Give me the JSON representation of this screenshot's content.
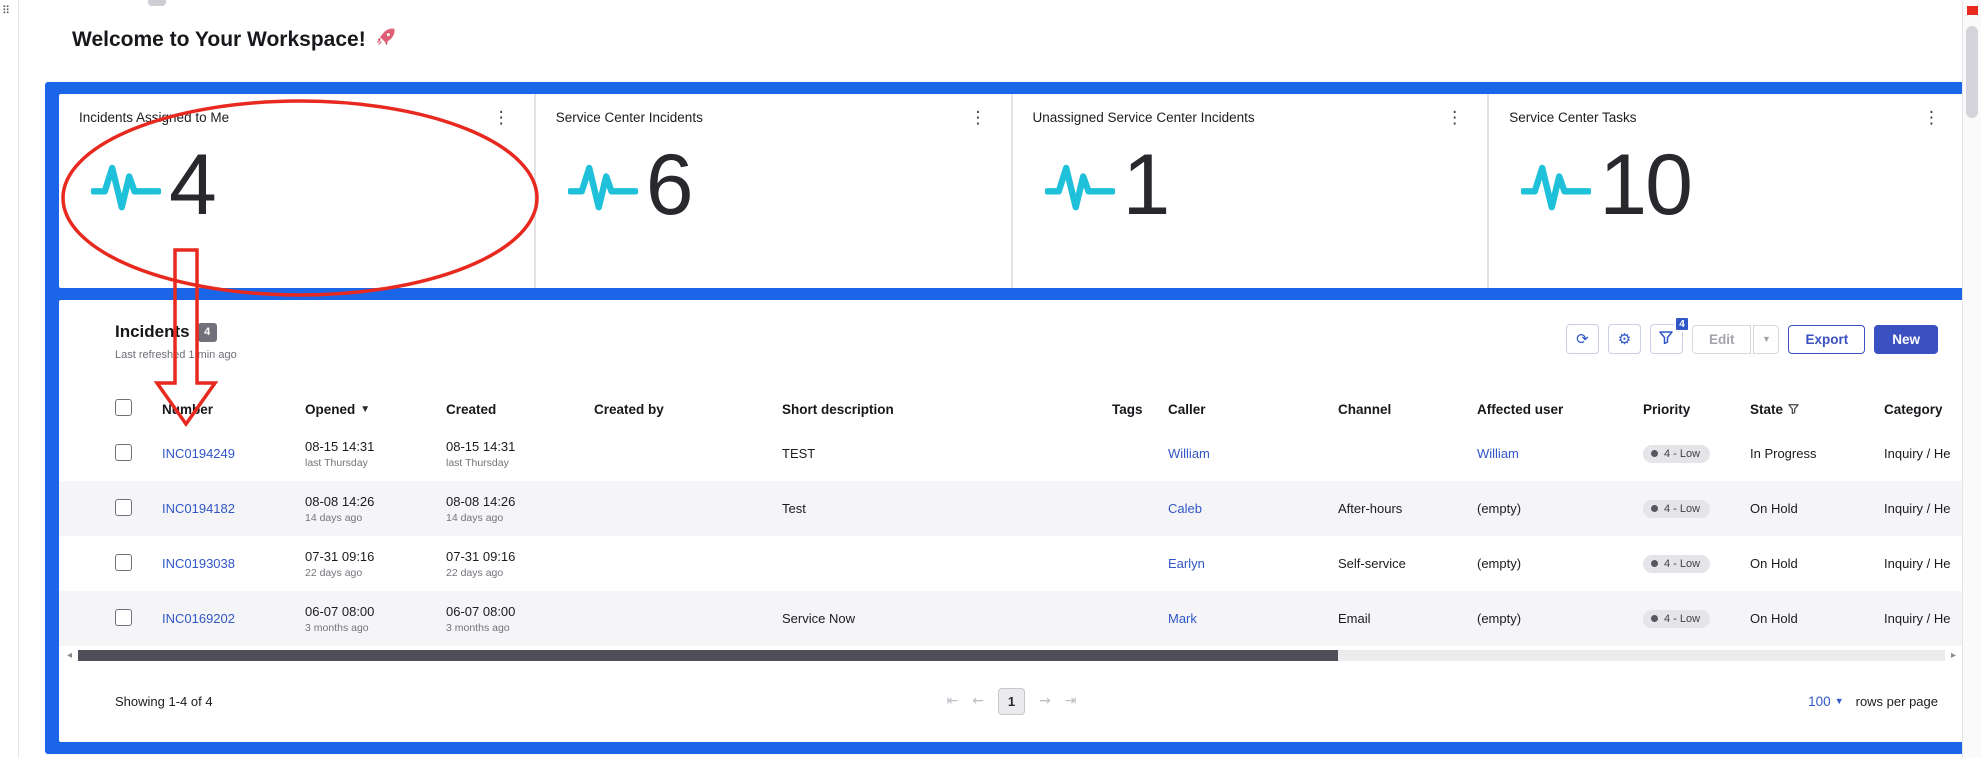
{
  "page": {
    "welcome_title": "Welcome to Your Workspace!",
    "title_icon": "rocket-emoji"
  },
  "cards": [
    {
      "title": "Incidents Assigned to Me",
      "value": "4",
      "icon": "pulse-icon",
      "menu_icon": "kebab-menu-icon"
    },
    {
      "title": "Service Center Incidents",
      "value": "6",
      "icon": "pulse-icon",
      "menu_icon": "kebab-menu-icon"
    },
    {
      "title": "Unassigned Service Center Incidents",
      "value": "1",
      "icon": "pulse-icon",
      "menu_icon": "kebab-menu-icon"
    },
    {
      "title": "Service Center Tasks",
      "value": "10",
      "icon": "pulse-icon",
      "menu_icon": "kebab-menu-icon"
    }
  ],
  "incidents": {
    "title": "Incidents",
    "count_badge": "4",
    "last_refreshed": "Last refreshed 1 min ago",
    "toolbar": {
      "refresh_icon": "⟳",
      "settings_icon": "⚙",
      "filter_badge": "4",
      "edit_label": "Edit",
      "edit_caret": "▼",
      "export_label": "Export",
      "new_label": "New"
    },
    "columns": {
      "number": "Number",
      "opened": "Opened",
      "created": "Created",
      "created_by": "Created by",
      "short_description": "Short description",
      "tags": "Tags",
      "caller": "Caller",
      "channel": "Channel",
      "affected_user": "Affected user",
      "priority": "Priority",
      "state": "State",
      "category": "Category"
    },
    "rows": [
      {
        "number": "INC0194249",
        "opened": "08-15 14:31",
        "opened_relative": "last Thursday",
        "created": "08-15 14:31",
        "created_relative": "last Thursday",
        "created_by": "",
        "short_description": "TEST",
        "tags": "",
        "caller": "William",
        "channel": "",
        "affected_user": "William",
        "priority": "4 - Low",
        "state": "In Progress",
        "category": "Inquiry / He"
      },
      {
        "number": "INC0194182",
        "opened": "08-08 14:26",
        "opened_relative": "14 days ago",
        "created": "08-08 14:26",
        "created_relative": "14 days ago",
        "created_by": "",
        "short_description": "Test",
        "tags": "",
        "caller": "Caleb",
        "channel": "After-hours",
        "affected_user": "(empty)",
        "priority": "4 - Low",
        "state": "On Hold",
        "category": "Inquiry / He"
      },
      {
        "number": "INC0193038",
        "opened": "07-31 09:16",
        "opened_relative": "22 days ago",
        "created": "07-31 09:16",
        "created_relative": "22 days ago",
        "created_by": "",
        "short_description": "",
        "tags": "",
        "caller": "Earlyn",
        "channel": "Self-service",
        "affected_user": "(empty)",
        "priority": "4 - Low",
        "state": "On Hold",
        "category": "Inquiry / He"
      },
      {
        "number": "INC0169202",
        "opened": "06-07 08:00",
        "opened_relative": "3 months ago",
        "created": "06-07 08:00",
        "created_relative": "3 months ago",
        "created_by": "",
        "short_description": "Service Now",
        "tags": "",
        "caller": "Mark",
        "channel": "Email",
        "affected_user": "(empty)",
        "priority": "4 - Low",
        "state": "On Hold",
        "category": "Inquiry / He"
      }
    ],
    "footer": {
      "showing": "Showing 1-4 of 4",
      "current_page": "1",
      "rows_per_page": "100",
      "rows_per_page_label": "rows per page"
    }
  },
  "colors": {
    "frame_blue": "#1b66e8",
    "accent_blue": "#3b50c1",
    "link_blue": "#3056c7",
    "pulse_cyan": "#1ec1d9",
    "annotation_red": "#e8291f"
  }
}
